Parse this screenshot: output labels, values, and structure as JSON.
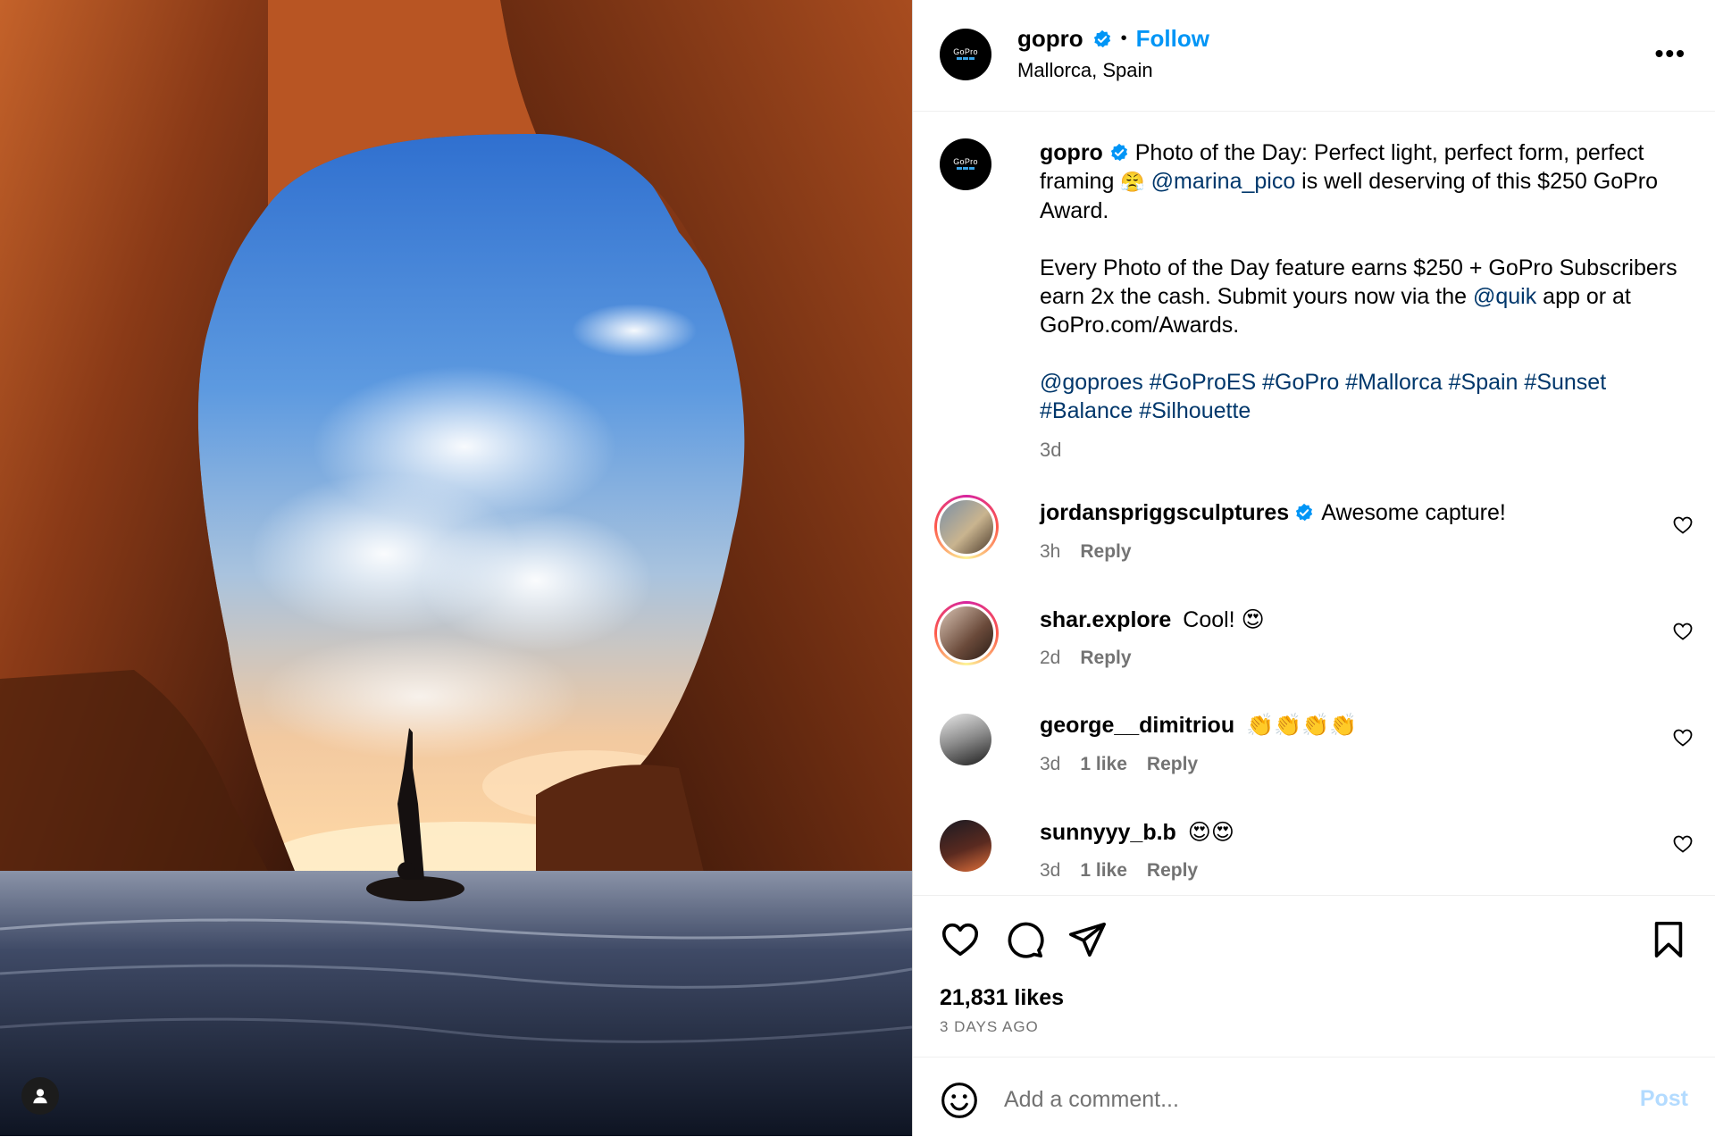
{
  "post": {
    "username": "gopro",
    "follow_label": "Follow",
    "separator": "•",
    "location": "Mallorca, Spain",
    "more_label": "•••",
    "logo_text": "GoPro"
  },
  "caption": {
    "username": "gopro",
    "text1_a": "Photo of the Day: Perfect light, perfect form, perfect framing ",
    "text1_emoji": "😤",
    "mention1": "@marina_pico",
    "text1_b": " is well deserving of this $250 GoPro Award.",
    "text2_a": "Every Photo of the Day feature earns $250 + GoPro Subscribers earn 2x the cash. Submit yours now via the ",
    "mention2": "@quik",
    "text2_b": " app or at GoPro.com/Awards.",
    "tags": [
      "@goproes",
      "#GoProES",
      "#GoPro",
      "#Mallorca",
      "#Spain",
      "#Sunset",
      "#Balance",
      "#Silhouette"
    ],
    "age": "3d"
  },
  "comments": [
    {
      "username": "jordanspriggsculptures",
      "verified": true,
      "text": "Awesome capture!",
      "age": "3h",
      "likes": "",
      "reply": "Reply"
    },
    {
      "username": "shar.explore",
      "verified": false,
      "text": "Cool! 😍",
      "age": "2d",
      "likes": "",
      "reply": "Reply"
    },
    {
      "username": "george__dimitriou",
      "verified": false,
      "text": "👏👏👏👏",
      "age": "3d",
      "likes": "1 like",
      "reply": "Reply"
    },
    {
      "username": "sunnyyy_b.b",
      "verified": false,
      "text": "😍😍",
      "age": "3d",
      "likes": "1 like",
      "reply": "Reply"
    }
  ],
  "footer": {
    "likes": "21,831 likes",
    "time_ago": "3 DAYS AGO",
    "comment_placeholder": "Add a comment...",
    "post_label": "Post"
  },
  "icons": {
    "like": "heart-icon",
    "comment": "comment-icon",
    "share": "paper-plane-icon",
    "save": "bookmark-icon",
    "emoji": "smiley-icon",
    "user_tag": "user-icon"
  },
  "colors": {
    "link": "#00376b",
    "follow": "#0095f6",
    "verified": "#0095f6",
    "muted": "#737373",
    "post_disabled": "#b3dbff"
  }
}
